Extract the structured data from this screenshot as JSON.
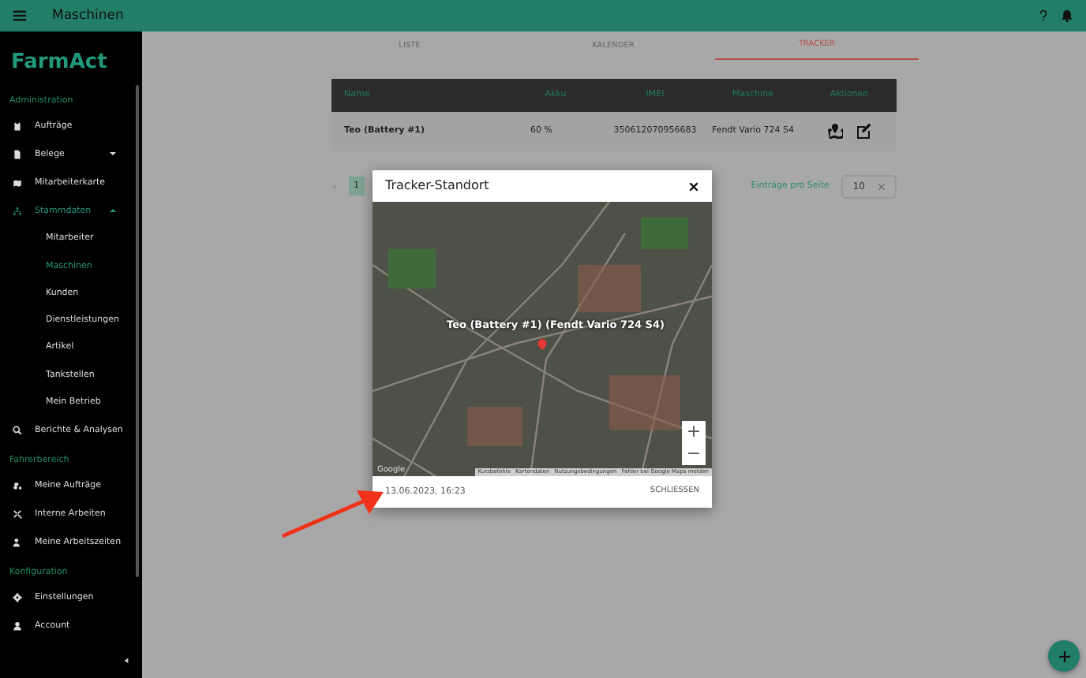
{
  "topbar": {
    "title": "Maschinen"
  },
  "sidebar": {
    "logo": "FarmAct",
    "sections": [
      {
        "title": "Administration",
        "items": [
          {
            "label": "Aufträge",
            "selected": false
          },
          {
            "label": "Belege",
            "selected": false,
            "expanded": false
          },
          {
            "label": "Mitarbeiterkarte",
            "selected": false
          },
          {
            "label": "Stammdaten",
            "selected": true,
            "expanded": true,
            "children": [
              {
                "label": "Mitarbeiter",
                "selected": false
              },
              {
                "label": "Maschinen",
                "selected": true
              },
              {
                "label": "Kunden",
                "selected": false
              },
              {
                "label": "Dienstleistungen",
                "selected": false
              },
              {
                "label": "Artikel",
                "selected": false
              },
              {
                "label": "Tankstellen",
                "selected": false
              },
              {
                "label": "Mein Betrieb",
                "selected": false
              }
            ]
          },
          {
            "label": "Berichte & Analysen",
            "selected": false
          }
        ]
      },
      {
        "title": "Fahrerbereich",
        "items": [
          {
            "label": "Meine Aufträge",
            "selected": false
          },
          {
            "label": "Interne Arbeiten",
            "selected": false
          },
          {
            "label": "Meine Arbeitszeiten",
            "selected": false
          }
        ]
      },
      {
        "title": "Konfiguration",
        "items": [
          {
            "label": "Einstellungen",
            "selected": false
          },
          {
            "label": "Account",
            "selected": false
          }
        ]
      }
    ]
  },
  "tabs": [
    {
      "label": "LISTE",
      "selected": false
    },
    {
      "label": "KALENDER",
      "selected": false
    },
    {
      "label": "TRACKER",
      "selected": true
    }
  ],
  "table": {
    "columns": [
      "Name",
      "Akku",
      "IMEI",
      "Maschine",
      "Aktionen"
    ],
    "rows": [
      {
        "name": "Teo (Battery #1)",
        "akku": "60 %",
        "imei": "350612070956683",
        "maschine": "Fendt Vario 724 S4"
      }
    ]
  },
  "pagination": {
    "pages": [
      {
        "label": "1",
        "selected": true
      }
    ],
    "per_page_label": "Einträge pro Seite",
    "per_page": "10"
  },
  "modal": {
    "title": "Tracker-Standort",
    "marker_label": "Teo (Battery #1) (Fendt Vario 724 S4)",
    "zoom_in": "+",
    "zoom_out": "−",
    "attribution": [
      "Kurzbefehle",
      "Kartendaten",
      "Nutzungsbedingungen",
      "Fehler bei Google Maps melden"
    ],
    "map_logo": "Google",
    "timestamp": "13.06.2023, 16:23",
    "close_button": "SCHLIESSEN"
  }
}
